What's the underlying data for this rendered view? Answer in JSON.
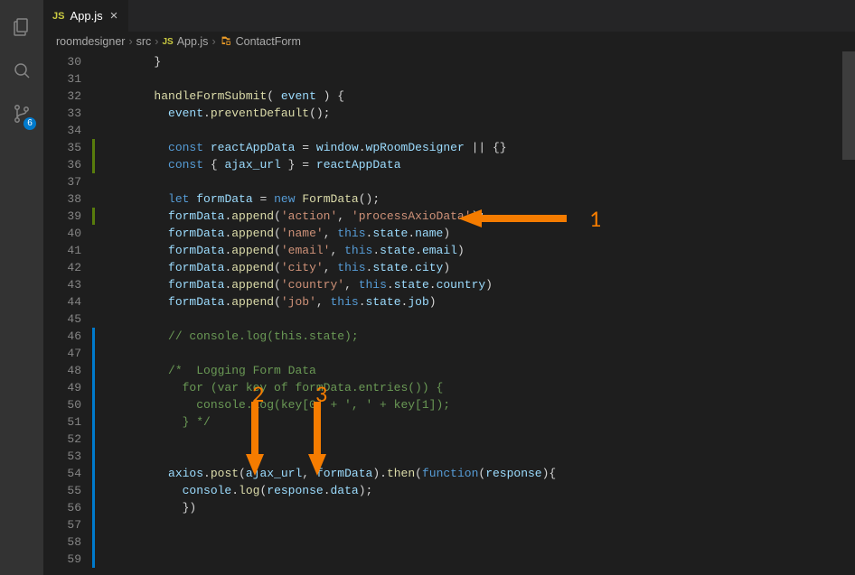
{
  "activity": {
    "scm_badge": "6"
  },
  "tab": {
    "file_icon": "JS",
    "filename": "App.js"
  },
  "breadcrumb": {
    "seg1": "roomdesigner",
    "seg2": "src",
    "seg3_icon": "JS",
    "seg3": "App.js",
    "seg4": "ContactForm"
  },
  "gutter": {
    "start": 30,
    "end": 59
  },
  "code_lines": [
    "        <span class='pn'>}</span>",
    "",
    "        <span class='fn'>handleFormSubmit</span><span class='pn'>( </span><span class='var'>event</span><span class='pn'> ) {</span>",
    "          <span class='var'>event</span><span class='pn'>.</span><span class='fn'>preventDefault</span><span class='pn'>();</span>",
    "",
    "          <span class='kw'>const</span> <span class='var'>reactAppData</span> <span class='pn'>=</span> <span class='var'>window</span><span class='pn'>.</span><span class='var'>wpRoomDesigner</span> <span class='pn'>|| {}</span>",
    "          <span class='kw'>const</span> <span class='pn'>{ </span><span class='var'>ajax_url</span><span class='pn'> } =</span> <span class='var'>reactAppData</span>",
    "",
    "          <span class='kw'>let</span> <span class='var'>formData</span> <span class='pn'>=</span> <span class='kw'>new</span> <span class='fn'>FormData</span><span class='pn'>();</span>",
    "          <span class='var'>formData</span><span class='pn'>.</span><span class='fn'>append</span><span class='pn'>(</span><span class='str'>'action'</span><span class='pn'>, </span><span class='str'>'processAxioData'</span><span class='pn'>);</span>",
    "          <span class='var'>formData</span><span class='pn'>.</span><span class='fn'>append</span><span class='pn'>(</span><span class='str'>'name'</span><span class='pn'>, </span><span class='this'>this</span><span class='pn'>.</span><span class='var'>state</span><span class='pn'>.</span><span class='var'>name</span><span class='pn'>)</span>",
    "          <span class='var'>formData</span><span class='pn'>.</span><span class='fn'>append</span><span class='pn'>(</span><span class='str'>'email'</span><span class='pn'>, </span><span class='this'>this</span><span class='pn'>.</span><span class='var'>state</span><span class='pn'>.</span><span class='var'>email</span><span class='pn'>)</span>",
    "          <span class='var'>formData</span><span class='pn'>.</span><span class='fn'>append</span><span class='pn'>(</span><span class='str'>'city'</span><span class='pn'>, </span><span class='this'>this</span><span class='pn'>.</span><span class='var'>state</span><span class='pn'>.</span><span class='var'>city</span><span class='pn'>)</span>",
    "          <span class='var'>formData</span><span class='pn'>.</span><span class='fn'>append</span><span class='pn'>(</span><span class='str'>'country'</span><span class='pn'>, </span><span class='this'>this</span><span class='pn'>.</span><span class='var'>state</span><span class='pn'>.</span><span class='var'>country</span><span class='pn'>)</span>",
    "          <span class='var'>formData</span><span class='pn'>.</span><span class='fn'>append</span><span class='pn'>(</span><span class='str'>'job'</span><span class='pn'>, </span><span class='this'>this</span><span class='pn'>.</span><span class='var'>state</span><span class='pn'>.</span><span class='var'>job</span><span class='pn'>)</span>",
    "",
    "          <span class='com'>// console.log(this.state);</span>",
    "",
    "          <span class='com'>/*  Logging Form Data</span>",
    "          <span class='com'>  for (var key of formData.entries()) {</span>",
    "          <span class='com'>    console.log(key[0] + ', ' + key[1]);</span>",
    "          <span class='com'>  } */</span>",
    "",
    "",
    "          <span class='var'>axios</span><span class='pn'>.</span><span class='fn'>post</span><span class='pn'>(</span><span class='var'>ajax_url</span><span class='pn'>, </span><span class='var'>formData</span><span class='pn'>).</span><span class='fn'>then</span><span class='pn'>(</span><span class='kw'>function</span><span class='pn'>(</span><span class='var'>response</span><span class='pn'>){</span>",
    "            <span class='var'>console</span><span class='pn'>.</span><span class='fn'>log</span><span class='pn'>(</span><span class='var'>response</span><span class='pn'>.</span><span class='var'>data</span><span class='pn'>);</span>",
    "            <span class='pn'>})</span>",
    "",
    "",
    ""
  ],
  "annotations": {
    "label1": "1",
    "label2": "2",
    "label3": "3"
  }
}
